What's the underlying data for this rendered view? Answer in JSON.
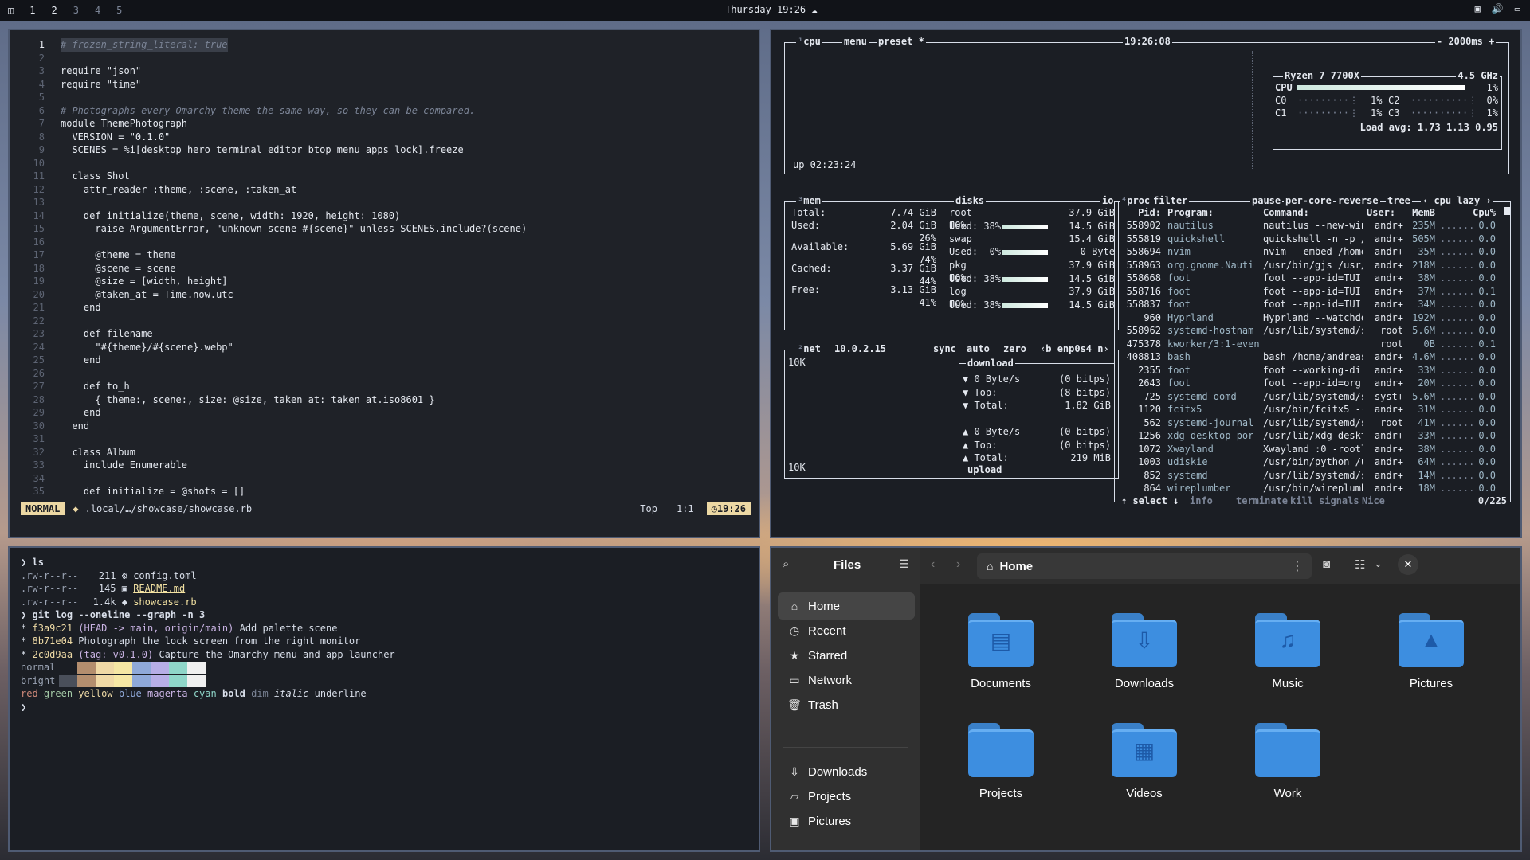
{
  "topbar": {
    "workspaces": [
      "1",
      "2",
      "3",
      "4",
      "5"
    ],
    "clock": "Thursday 19:26"
  },
  "editor": {
    "lines": [
      {
        "n": "1",
        "t": "# frozen_string_literal: true"
      },
      {
        "n": "2",
        "t": ""
      },
      {
        "n": "3",
        "t": "require \"json\""
      },
      {
        "n": "4",
        "t": "require \"time\""
      },
      {
        "n": "5",
        "t": ""
      },
      {
        "n": "6",
        "t": "# Photographs every Omarchy theme the same way, so they can be compared."
      },
      {
        "n": "7",
        "t": "module ThemePhotograph"
      },
      {
        "n": "8",
        "t": "  VERSION = \"0.1.0\""
      },
      {
        "n": "9",
        "t": "  SCENES = %i[desktop hero terminal editor btop menu apps lock].freeze"
      },
      {
        "n": "10",
        "t": ""
      },
      {
        "n": "11",
        "t": "  class Shot"
      },
      {
        "n": "12",
        "t": "    attr_reader :theme, :scene, :taken_at"
      },
      {
        "n": "13",
        "t": ""
      },
      {
        "n": "14",
        "t": "    def initialize(theme, scene, width: 1920, height: 1080)"
      },
      {
        "n": "15",
        "t": "      raise ArgumentError, \"unknown scene #{scene}\" unless SCENES.include?(scene)"
      },
      {
        "n": "16",
        "t": ""
      },
      {
        "n": "17",
        "t": "      @theme = theme"
      },
      {
        "n": "18",
        "t": "      @scene = scene"
      },
      {
        "n": "19",
        "t": "      @size = [width, height]"
      },
      {
        "n": "20",
        "t": "      @taken_at = Time.now.utc"
      },
      {
        "n": "21",
        "t": "    end"
      },
      {
        "n": "22",
        "t": ""
      },
      {
        "n": "23",
        "t": "    def filename"
      },
      {
        "n": "24",
        "t": "      \"#{theme}/#{scene}.webp\""
      },
      {
        "n": "25",
        "t": "    end"
      },
      {
        "n": "26",
        "t": ""
      },
      {
        "n": "27",
        "t": "    def to_h"
      },
      {
        "n": "28",
        "t": "      { theme:, scene:, size: @size, taken_at: taken_at.iso8601 }"
      },
      {
        "n": "29",
        "t": "    end"
      },
      {
        "n": "30",
        "t": "  end"
      },
      {
        "n": "31",
        "t": ""
      },
      {
        "n": "32",
        "t": "  class Album"
      },
      {
        "n": "33",
        "t": "    include Enumerable"
      },
      {
        "n": "34",
        "t": ""
      },
      {
        "n": "35",
        "t": "    def initialize = @shots = []"
      }
    ],
    "status": {
      "mode": "NORMAL",
      "file": ".local/…/showcase/showcase.rb",
      "pos": "Top",
      "cursor": "1:1",
      "time": "19:26"
    }
  },
  "btop": {
    "cpu": {
      "title": "cpu",
      "menu": "menu",
      "preset": "preset *",
      "clock": "19:26:08",
      "interval": "- 2000ms +",
      "uptime": "up 02:23:24",
      "model": "Ryzen 7 7700X",
      "freq": "4.5 GHz",
      "total_label": "CPU",
      "total_pct": "1%",
      "cores": [
        {
          "n": "C0",
          "p": "1%"
        },
        {
          "n": "C2",
          "p": "0%"
        },
        {
          "n": "C1",
          "p": "1%"
        },
        {
          "n": "C3",
          "p": "1%"
        }
      ],
      "load": "Load avg: 1.73 1.13 0.95"
    },
    "mem": {
      "title": "mem",
      "rows": [
        {
          "k": "Total:",
          "v": "7.74 GiB"
        },
        {
          "k": "Used:",
          "v": "2.04 GiB",
          "p": "26%"
        },
        {
          "k": "Available:",
          "v": "5.69 GiB",
          "p": "74%"
        },
        {
          "k": "Cached:",
          "v": "3.37 GiB",
          "p": "44%"
        },
        {
          "k": "Free:",
          "v": "3.13 GiB",
          "p": "41%"
        }
      ]
    },
    "disks": {
      "title": "disks",
      "io": "io",
      "rows": [
        {
          "name": "root",
          "size": "37.9 GiB",
          "io": "IO%",
          "used": "Used: 38%",
          "usedv": "14.5 GiB"
        },
        {
          "name": "swap",
          "size": "15.4 GiB",
          "io": "",
          "used": "Used:  0%",
          "usedv": "0 Byte"
        },
        {
          "name": "pkg",
          "size": "37.9 GiB",
          "io": "IO%",
          "used": "Used: 38%",
          "usedv": "14.5 GiB"
        },
        {
          "name": "log",
          "size": "37.9 GiB",
          "io": "IO%",
          "used": "Used: 38%",
          "usedv": "14.5 GiB"
        }
      ]
    },
    "net": {
      "title": "net",
      "ip": "10.0.2.15",
      "sync": "sync",
      "auto": "auto",
      "zero": "zero",
      "iface": "enp0s4",
      "scale_top": "10K",
      "scale_bottom": "10K",
      "download": "download",
      "upload": "upload",
      "down_rows": [
        {
          "k": "▼ 0 Byte/s",
          "v": "(0 bitps)"
        },
        {
          "k": "▼ Top:",
          "v": "(8 bitps)"
        },
        {
          "k": "▼ Total:",
          "v": "1.82 GiB"
        }
      ],
      "up_rows": [
        {
          "k": "▲ 0 Byte/s",
          "v": "(0 bitps)"
        },
        {
          "k": "▲ Top:",
          "v": "(0 bitps)"
        },
        {
          "k": "▲ Total:",
          "v": "219 MiB"
        }
      ]
    },
    "proc": {
      "title": "proc",
      "filter": "filter",
      "pause": "pause",
      "percore": "per-core",
      "reverse": "reverse",
      "tree": "tree",
      "sort": "cpu lazy",
      "headers": [
        "Pid:",
        "Program:",
        "Command:",
        "User:",
        "MemB",
        "Cpu%"
      ],
      "rows": [
        [
          "558902",
          "nautilus",
          "nautilus --new-win",
          "andr+",
          "235M",
          "0.0"
        ],
        [
          "555819",
          "quickshell",
          "quickshell -n -p /",
          "andr+",
          "505M",
          "0.0"
        ],
        [
          "558694",
          "nvim",
          "nvim --embed /home",
          "andr+",
          "35M",
          "0.0"
        ],
        [
          "558963",
          "org.gnome.Nauti",
          "/usr/bin/gjs /usr/",
          "andr+",
          "218M",
          "0.0"
        ],
        [
          "558668",
          "foot",
          "foot --app-id=TUI.",
          "andr+",
          "38M",
          "0.0"
        ],
        [
          "558716",
          "foot",
          "foot --app-id=TUI.",
          "andr+",
          "37M",
          "0.1"
        ],
        [
          "558837",
          "foot",
          "foot --app-id=TUI.",
          "andr+",
          "34M",
          "0.0"
        ],
        [
          "960",
          "Hyprland",
          "Hyprland --watchdo",
          "andr+",
          "192M",
          "0.0"
        ],
        [
          "558962",
          "systemd-hostnam",
          "/usr/lib/systemd/s",
          "root",
          "5.6M",
          "0.0"
        ],
        [
          "475378",
          "kworker/3:1-even",
          "",
          "root",
          "0B",
          "0.1"
        ],
        [
          "408813",
          "bash",
          "bash /home/andreas",
          "andr+",
          "4.6M",
          "0.0"
        ],
        [
          "2355",
          "foot",
          "foot --working-dir",
          "andr+",
          "33M",
          "0.0"
        ],
        [
          "2643",
          "foot",
          "foot --app-id=org.",
          "andr+",
          "20M",
          "0.0"
        ],
        [
          "725",
          "systemd-oomd",
          "/usr/lib/systemd/s",
          "syst+",
          "5.6M",
          "0.0"
        ],
        [
          "1120",
          "fcitx5",
          "/usr/bin/fcitx5 --",
          "andr+",
          "31M",
          "0.0"
        ],
        [
          "562",
          "systemd-journal",
          "/usr/lib/systemd/s",
          "root",
          "41M",
          "0.0"
        ],
        [
          "1256",
          "xdg-desktop-por",
          "/usr/lib/xdg-deskt",
          "andr+",
          "33M",
          "0.0"
        ],
        [
          "1072",
          "Xwayland",
          "Xwayland :0 -rootl",
          "andr+",
          "38M",
          "0.0"
        ],
        [
          "1003",
          "udiskie",
          "/usr/bin/python /u",
          "andr+",
          "64M",
          "0.0"
        ],
        [
          "852",
          "systemd",
          "/usr/lib/systemd/s",
          "andr+",
          "14M",
          "0.0"
        ],
        [
          "864",
          "wireplumber",
          "/usr/bin/wireplumb",
          "andr+",
          "18M",
          "0.0"
        ]
      ],
      "footer": {
        "select": "select",
        "info": "info",
        "terminate": "terminate",
        "kill": "kill",
        "signals": "signals",
        "nice": "Nice",
        "count": "0/225"
      }
    }
  },
  "terminal": {
    "ls_cmd": "ls",
    "files": [
      {
        "perm": ".rw-r--r--",
        "size": "211",
        "icon": "⚙",
        "name": "config.toml"
      },
      {
        "perm": ".rw-r--r--",
        "size": "145",
        "icon": "▣",
        "name": "README.md"
      },
      {
        "perm": ".rw-r--r--",
        "size": "1.4k",
        "icon": "◆",
        "name": "showcase.rb"
      }
    ],
    "git_cmd": "git log --oneline --graph -n 3",
    "commits": [
      {
        "hash": "f3a9c21",
        "ref": "(HEAD -> main, origin/main)",
        "msg": "Add palette scene"
      },
      {
        "hash": "8b71e04",
        "ref": "",
        "msg": "Photograph the lock screen from the right monitor"
      },
      {
        "hash": "2c0d9aa",
        "ref": "(tag: v0.1.0)",
        "msg": "Capture the Omarchy menu and app launcher"
      }
    ],
    "normal": "normal",
    "bright": "bright",
    "palette_normal": [
      "#1b1e24",
      "#b48e6e",
      "#f0d9a6",
      "#f6e7a4",
      "#8fa9d9",
      "#b7aee6",
      "#8fd6c9",
      "#f0f0f0"
    ],
    "palette_bright": [
      "#4a4f5a",
      "#b48e6e",
      "#f0d9a6",
      "#f6e7a4",
      "#8fa9d9",
      "#b7aee6",
      "#8fd6c9",
      "#f0f0f0"
    ],
    "styles": [
      "red",
      "green",
      "yellow",
      "blue",
      "magenta",
      "cyan",
      "bold",
      "dim",
      "italic",
      "underline"
    ]
  },
  "files": {
    "title": "Files",
    "location": "Home",
    "places": [
      {
        "icon": "⌂",
        "label": "Home",
        "selected": true
      },
      {
        "icon": "◷",
        "label": "Recent"
      },
      {
        "icon": "★",
        "label": "Starred"
      },
      {
        "icon": "▭",
        "label": "Network"
      },
      {
        "icon": "🗑",
        "label": "Trash"
      }
    ],
    "bookmarks": [
      {
        "icon": "⇩",
        "label": "Downloads"
      },
      {
        "icon": "▱",
        "label": "Projects"
      },
      {
        "icon": "▣",
        "label": "Pictures"
      }
    ],
    "folders": [
      {
        "label": "Documents",
        "glyph": "▤"
      },
      {
        "label": "Downloads",
        "glyph": "⇩"
      },
      {
        "label": "Music",
        "glyph": "♫"
      },
      {
        "label": "Pictures",
        "glyph": "▲"
      },
      {
        "label": "Projects",
        "glyph": ""
      },
      {
        "label": "Videos",
        "glyph": "▦"
      },
      {
        "label": "Work",
        "glyph": ""
      }
    ]
  }
}
